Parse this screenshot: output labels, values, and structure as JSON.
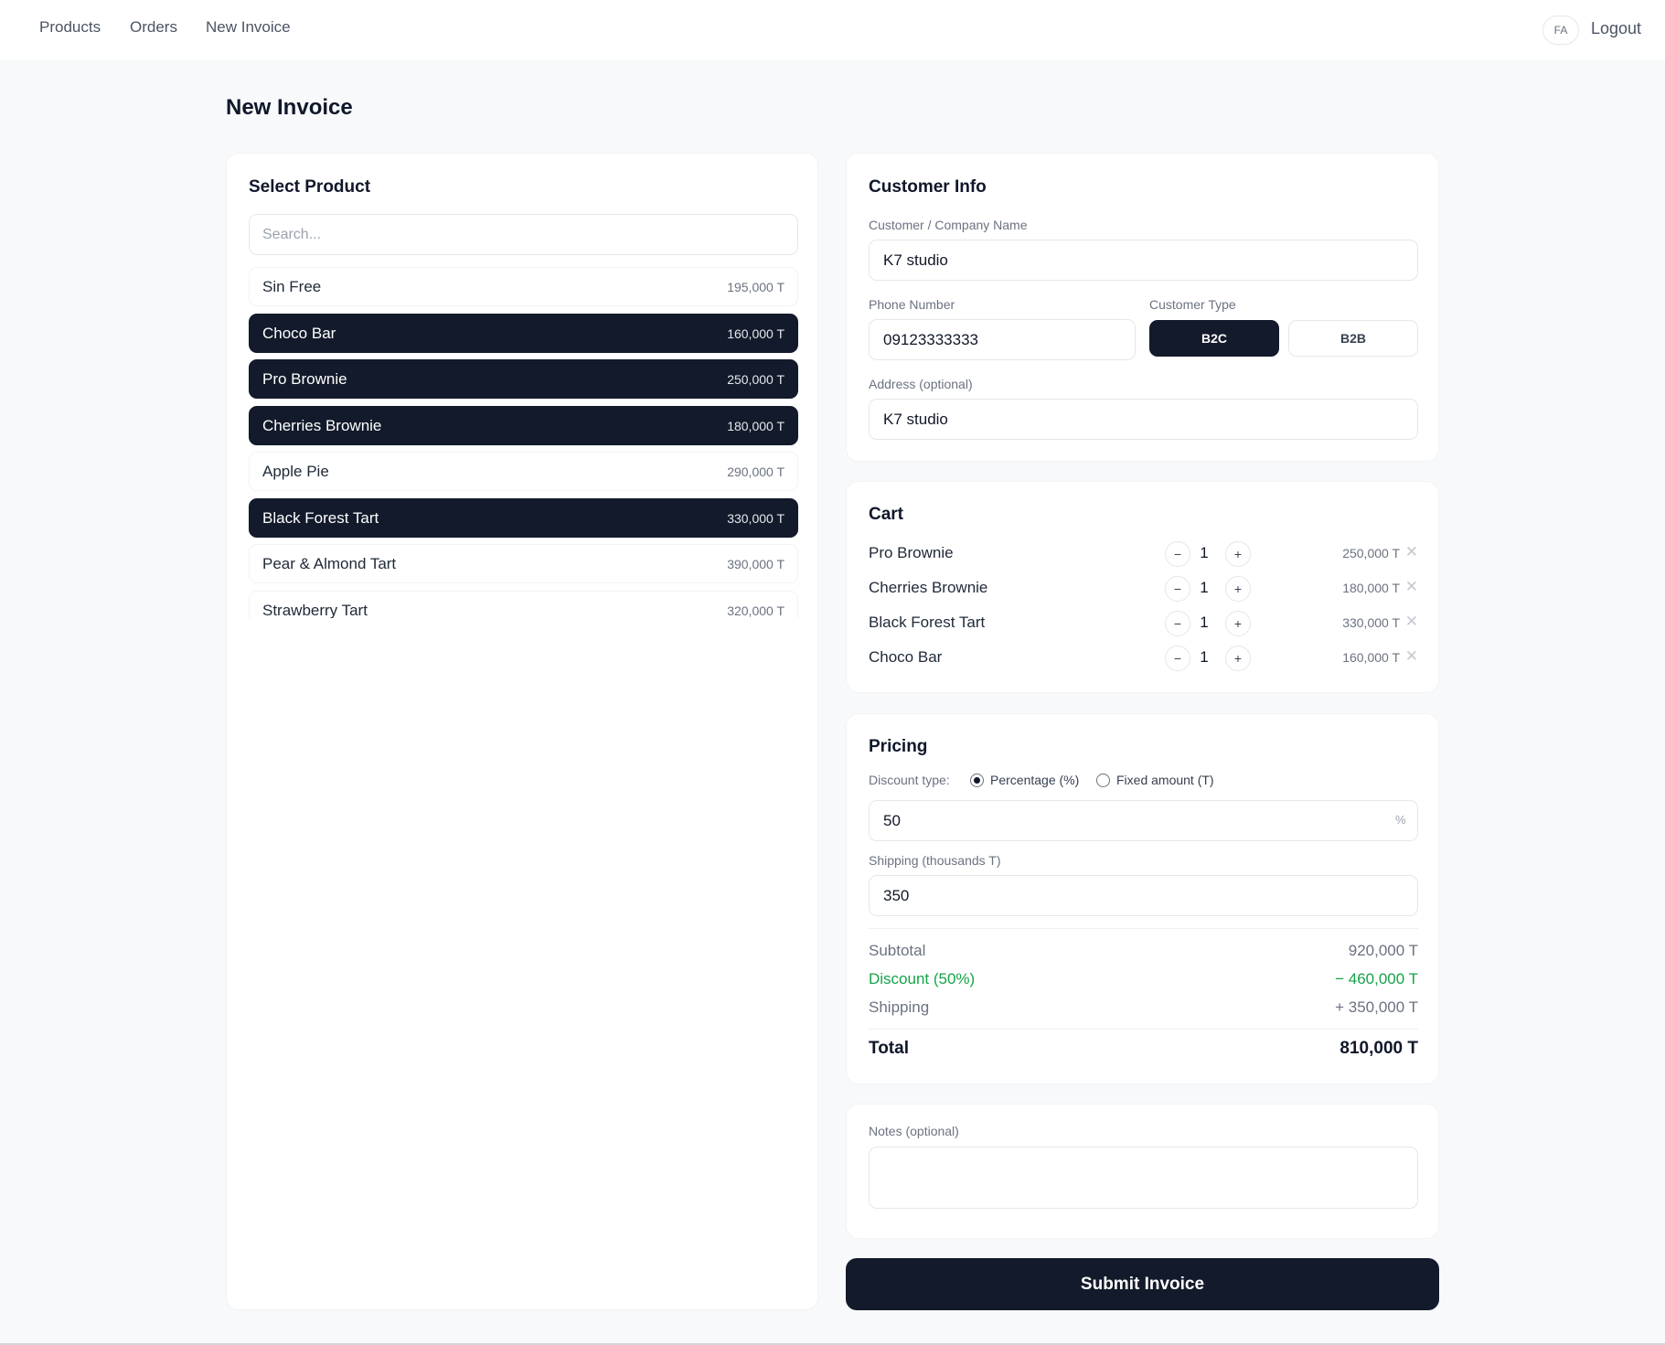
{
  "nav": {
    "links": [
      "Products",
      "Orders",
      "New Invoice"
    ],
    "lang": "FA",
    "logout": "Logout"
  },
  "page": {
    "title": "New Invoice"
  },
  "products": {
    "title": "Select Product",
    "search_placeholder": "Search...",
    "items": [
      {
        "name": "Sin Free",
        "price": "195,000 T",
        "selected": false
      },
      {
        "name": "Choco Bar",
        "price": "160,000 T",
        "selected": true
      },
      {
        "name": "Pro Brownie",
        "price": "250,000 T",
        "selected": true
      },
      {
        "name": "Cherries Brownie",
        "price": "180,000 T",
        "selected": true
      },
      {
        "name": "Apple Pie",
        "price": "290,000 T",
        "selected": false
      },
      {
        "name": "Black Forest Tart",
        "price": "330,000 T",
        "selected": true
      },
      {
        "name": "Pear & Almond Tart",
        "price": "390,000 T",
        "selected": false
      },
      {
        "name": "Strawberry Tart",
        "price": "320,000 T",
        "selected": false
      }
    ]
  },
  "customer": {
    "title": "Customer Info",
    "name_label": "Customer / Company Name",
    "name_value": "K7 studio",
    "phone_label": "Phone Number",
    "phone_value": "09123333333",
    "type_label": "Customer Type",
    "type_options": [
      "B2C",
      "B2B"
    ],
    "type_selected": "B2C",
    "address_label": "Address (optional)",
    "address_value": "K7 studio"
  },
  "cart": {
    "title": "Cart",
    "items": [
      {
        "name": "Pro Brownie",
        "qty": "1",
        "price": "250,000 T"
      },
      {
        "name": "Cherries Brownie",
        "qty": "1",
        "price": "180,000 T"
      },
      {
        "name": "Black Forest Tart",
        "qty": "1",
        "price": "330,000 T"
      },
      {
        "name": "Choco Bar",
        "qty": "1",
        "price": "160,000 T"
      }
    ]
  },
  "pricing": {
    "title": "Pricing",
    "discount_type_label": "Discount type:",
    "discount_options": [
      "Percentage (%)",
      "Fixed amount (T)"
    ],
    "discount_selected": "Percentage (%)",
    "discount_value": "50",
    "discount_suffix": "%",
    "shipping_label": "Shipping (thousands T)",
    "shipping_value": "350",
    "subtotal_label": "Subtotal",
    "subtotal_value": "920,000 T",
    "discount_label": "Discount (50%)",
    "discount_amount": "− 460,000 T",
    "shipping_sum_label": "Shipping",
    "shipping_sum_value": "+ 350,000 T",
    "total_label": "Total",
    "total_value": "810,000 T"
  },
  "notes": {
    "label": "Notes (optional)",
    "value": ""
  },
  "submit_label": "Submit Invoice",
  "colors": {
    "primary": "#131a2b",
    "discount_green": "#16a34a",
    "background": "#f8f9fa"
  },
  "icons": {
    "remove": "close-icon",
    "minus": "minus-icon",
    "plus": "plus-icon"
  }
}
